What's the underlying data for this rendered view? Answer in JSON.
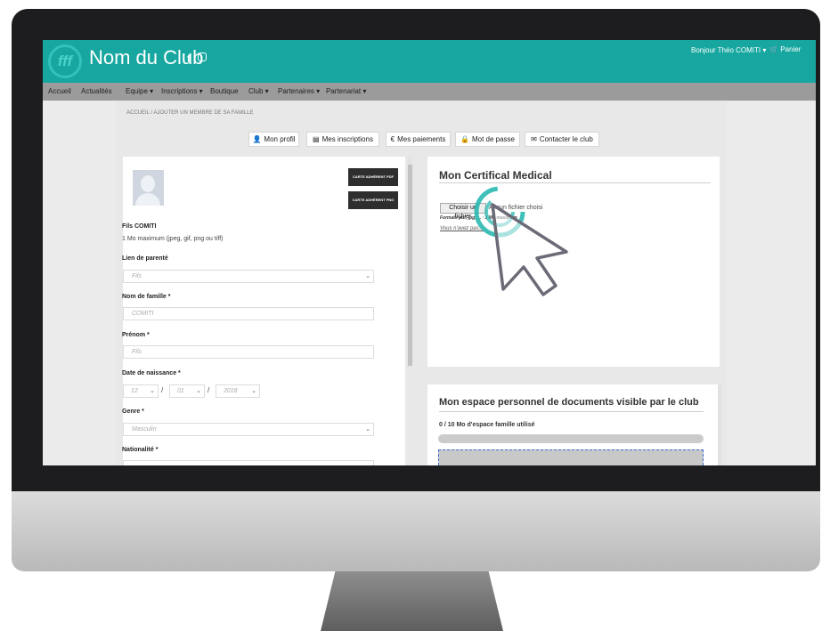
{
  "header": {
    "logo_text": "fff",
    "club_name": "Nom du Club",
    "social_facebook": "f",
    "greeting": "Bonjour Théo COMITI ▾",
    "cart_label": "Panier"
  },
  "nav": {
    "items": [
      "Accueil",
      "Actualités",
      "Equipe ▾",
      "Inscriptions ▾",
      "Boutique",
      "Club ▾",
      "Partenaires ▾",
      "Partenariat ▾"
    ]
  },
  "breadcrumb": "ACCUEIL  /  AJOUTER UN MEMBRE DE SA FAMILLE",
  "tabs": [
    {
      "label": "Mon profil",
      "icon": "user-icon",
      "glyph": "👤"
    },
    {
      "label": "Mes inscriptions",
      "icon": "list-icon",
      "glyph": "▤"
    },
    {
      "label": "Mes paiements",
      "icon": "euro-icon",
      "glyph": "€"
    },
    {
      "label": "Mot de passe",
      "icon": "lock-icon",
      "glyph": "🔒"
    },
    {
      "label": "Contacter le club",
      "icon": "envelope-icon",
      "glyph": "✉"
    }
  ],
  "profile": {
    "card_pdf": "CARTE ADHÉRENT PDF",
    "card_png": "CARTE ADHÉRENT PNG",
    "name": "Fils COMITI",
    "photo_hint": "1 Mo maximum (jpeg, gif, png ou tiff)"
  },
  "form": {
    "relation_label": "Lien de parenté",
    "relation_value": "Fils",
    "lastname_label": "Nom de famille *",
    "lastname_value": "COMITI",
    "firstname_label": "Prénom *",
    "firstname_value": "Fils",
    "birthdate_label": "Date de naissance *",
    "birth_day": "12",
    "birth_month": "01",
    "birth_year": "2018",
    "date_sep": "/",
    "gender_label": "Genre *",
    "gender_value": "Masculin",
    "nationality_label": "Nationalité *"
  },
  "certificate": {
    "title": "Mon Certifical Medical",
    "choose_file": "Choisir un fichier",
    "no_file": "Aucun fichier choisi",
    "formats": "Formats pdf, jpg, ... · 1 Mo maximum",
    "no_certificate": "Vous n'avez pas..."
  },
  "documents": {
    "title": "Mon espace personnel de documents visible par le club",
    "storage": "0 / 10 Mo d'espace famille utilisé",
    "storage_used_fraction": 0
  },
  "colors": {
    "header_bg": "#17a7a0",
    "nav_bg": "#9b9b9b",
    "cursor_ring": "#1fb5ad"
  }
}
